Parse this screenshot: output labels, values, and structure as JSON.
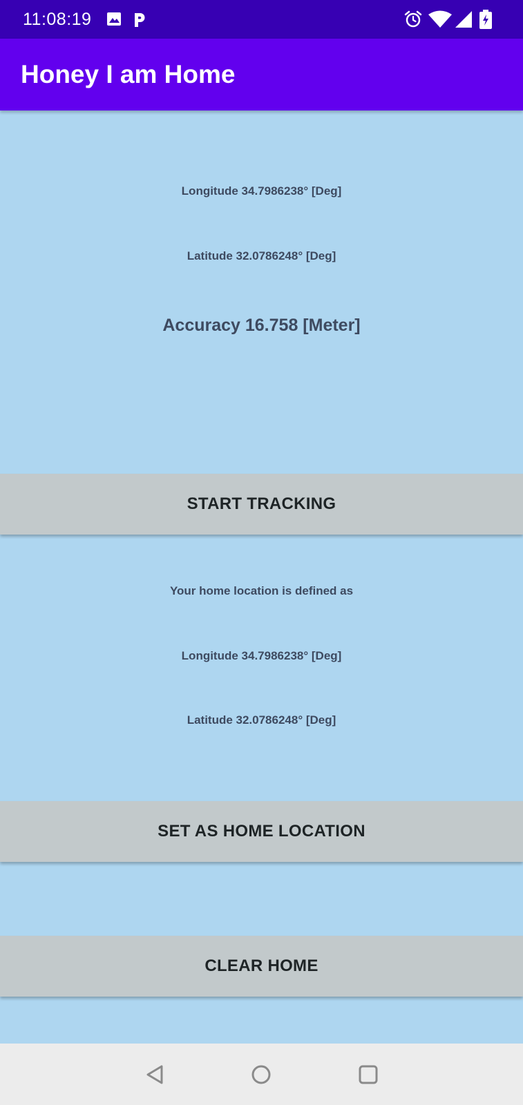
{
  "status_bar": {
    "time": "11:08:19",
    "icons": [
      "image-icon",
      "p-icon",
      "alarm-icon",
      "wifi-icon",
      "signal-icon",
      "battery-icon"
    ],
    "background_color": "#3700B3"
  },
  "app_bar": {
    "title": "Honey I am Home",
    "background_color": "#6200EE"
  },
  "current_location": {
    "longitude_text": "Longitude 34.7986238°  [Deg]",
    "latitude_text": "Latitude 32.0786248° [Deg]",
    "accuracy_text": "Accuracy 16.758 [Meter]"
  },
  "buttons": {
    "start_tracking": "START TRACKING",
    "set_home": "SET AS HOME LOCATION",
    "clear_home": "CLEAR HOME"
  },
  "home_location": {
    "heading": "Your home location is defined as",
    "longitude_text": "Longitude 34.7986238°  [Deg]",
    "latitude_text": "Latitude 32.0786248° [Deg]"
  },
  "navigation_bar": {
    "icons": [
      "back-icon",
      "home-icon",
      "recents-icon"
    ]
  },
  "colors": {
    "background": "#AED6F0",
    "button": "#C2C9CB",
    "text": "#3E4A60"
  }
}
